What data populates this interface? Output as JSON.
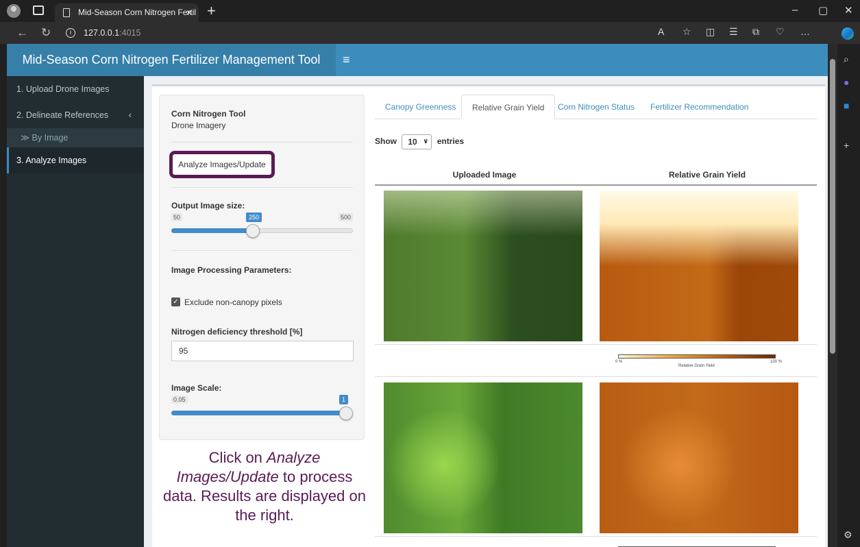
{
  "browser": {
    "tab_title": "Mid-Season Corn Nitrogen Fertil",
    "tab_close": "×",
    "new_tab": "+",
    "url_host": "127.0.0.1",
    "url_port": ":4015",
    "win_min": "–",
    "win_restore": "▢",
    "win_close": "✕"
  },
  "header": {
    "title": "Mid-Season Corn Nitrogen Fertilizer Management Tool",
    "menu_icon": "≡"
  },
  "sidebar": {
    "items": [
      {
        "label": "1. Upload Drone Images"
      },
      {
        "label": "2. Delineate References"
      },
      {
        "label": "≫ By Image"
      },
      {
        "label": "3. Analyze Images"
      }
    ],
    "chevron": "‹"
  },
  "controls": {
    "tool_title": "Corn Nitrogen Tool",
    "tool_sub": "Drone Imagery",
    "analyze_label": "Analyze Images/Update",
    "output_size_label": "Output Image size:",
    "output_min": "50",
    "output_val": "250",
    "output_max": "500",
    "output_fraction": 0.4444,
    "proc_label": "Image Processing Parameters:",
    "exclude_label": "Exclude non-canopy pixels",
    "threshold_label": "Nitrogen deficiency threshold [%]",
    "threshold_value": "95",
    "scale_label": "Image Scale:",
    "scale_min": "0.05",
    "scale_val": "1",
    "scale_fraction": 1.0
  },
  "callout": {
    "line1": "Click on ",
    "italic": "Analyze Images/Update",
    "line2": " to process data. Results are displayed on the right."
  },
  "tabs": [
    {
      "label": "Canopy Greenness"
    },
    {
      "label": "Relative Grain Yield"
    },
    {
      "label": "Corn Nitrogen Status"
    },
    {
      "label": "Fertilizer Recommendation"
    }
  ],
  "table": {
    "show_label": "Show",
    "entries_value": "10",
    "entries_label": "entries",
    "col1": "Uploaded Image",
    "col2": "Relative Grain Yield"
  },
  "colorbar": {
    "min": "0 %",
    "max": "100 %",
    "label": "Relative Grain Yield"
  },
  "colors": {
    "header": "#3c8dbc",
    "logo": "#367fa9",
    "sidebar": "#222d32",
    "highlight": "#5b1a55"
  }
}
